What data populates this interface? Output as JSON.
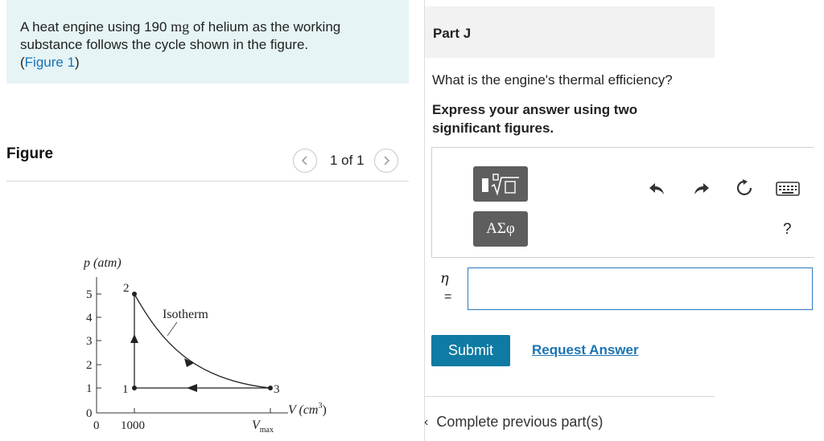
{
  "problem": {
    "text_a": "A heat engine using 190 ",
    "mass_unit": "mg",
    "text_b": " of helium as the working substance follows the cycle shown in the figure.",
    "open_paren": "(",
    "figure_link": "Figure 1",
    "close_paren": ")"
  },
  "figure": {
    "heading": "Figure",
    "pager_text": "1 of 1",
    "prev_icon": "chevron-left-icon",
    "next_icon": "chevron-right-icon",
    "y_axis_label": "p (atm)",
    "x_axis_label_main": "V (cm",
    "x_axis_label_exp": "3",
    "x_axis_label_close": ")",
    "y_ticks": [
      "0",
      "1",
      "2",
      "3",
      "4",
      "5"
    ],
    "x_tick_0": "0",
    "x_tick_1000": "1000",
    "vmax_main": "V",
    "vmax_sub": "max",
    "curve_label": "Isotherm",
    "point_labels": [
      "1",
      "2",
      "3"
    ]
  },
  "part": {
    "title": "Part J",
    "question": "What is the engine's thermal efficiency?",
    "instruction": "Express your answer using two significant figures."
  },
  "toolbar": {
    "template_icon": "fraction-radical-template-icon",
    "greek_label": "ΑΣφ",
    "undo_icon": "undo-icon",
    "redo_icon": "redo-icon",
    "reset_icon": "reset-icon",
    "keyboard_icon": "keyboard-icon",
    "help_label": "?"
  },
  "answer": {
    "variable": "η",
    "equals": "=",
    "value": ""
  },
  "actions": {
    "submit_label": "Submit",
    "request_label": "Request Answer"
  },
  "footer": {
    "prev_chevron": "‹",
    "prev_label": "Complete previous part(s)"
  },
  "colors": {
    "problem_bg": "#e6f4f6",
    "link": "#1a73b5",
    "submit_bg": "#0f7aa3",
    "toolbar_btn": "#5e5e5e"
  }
}
